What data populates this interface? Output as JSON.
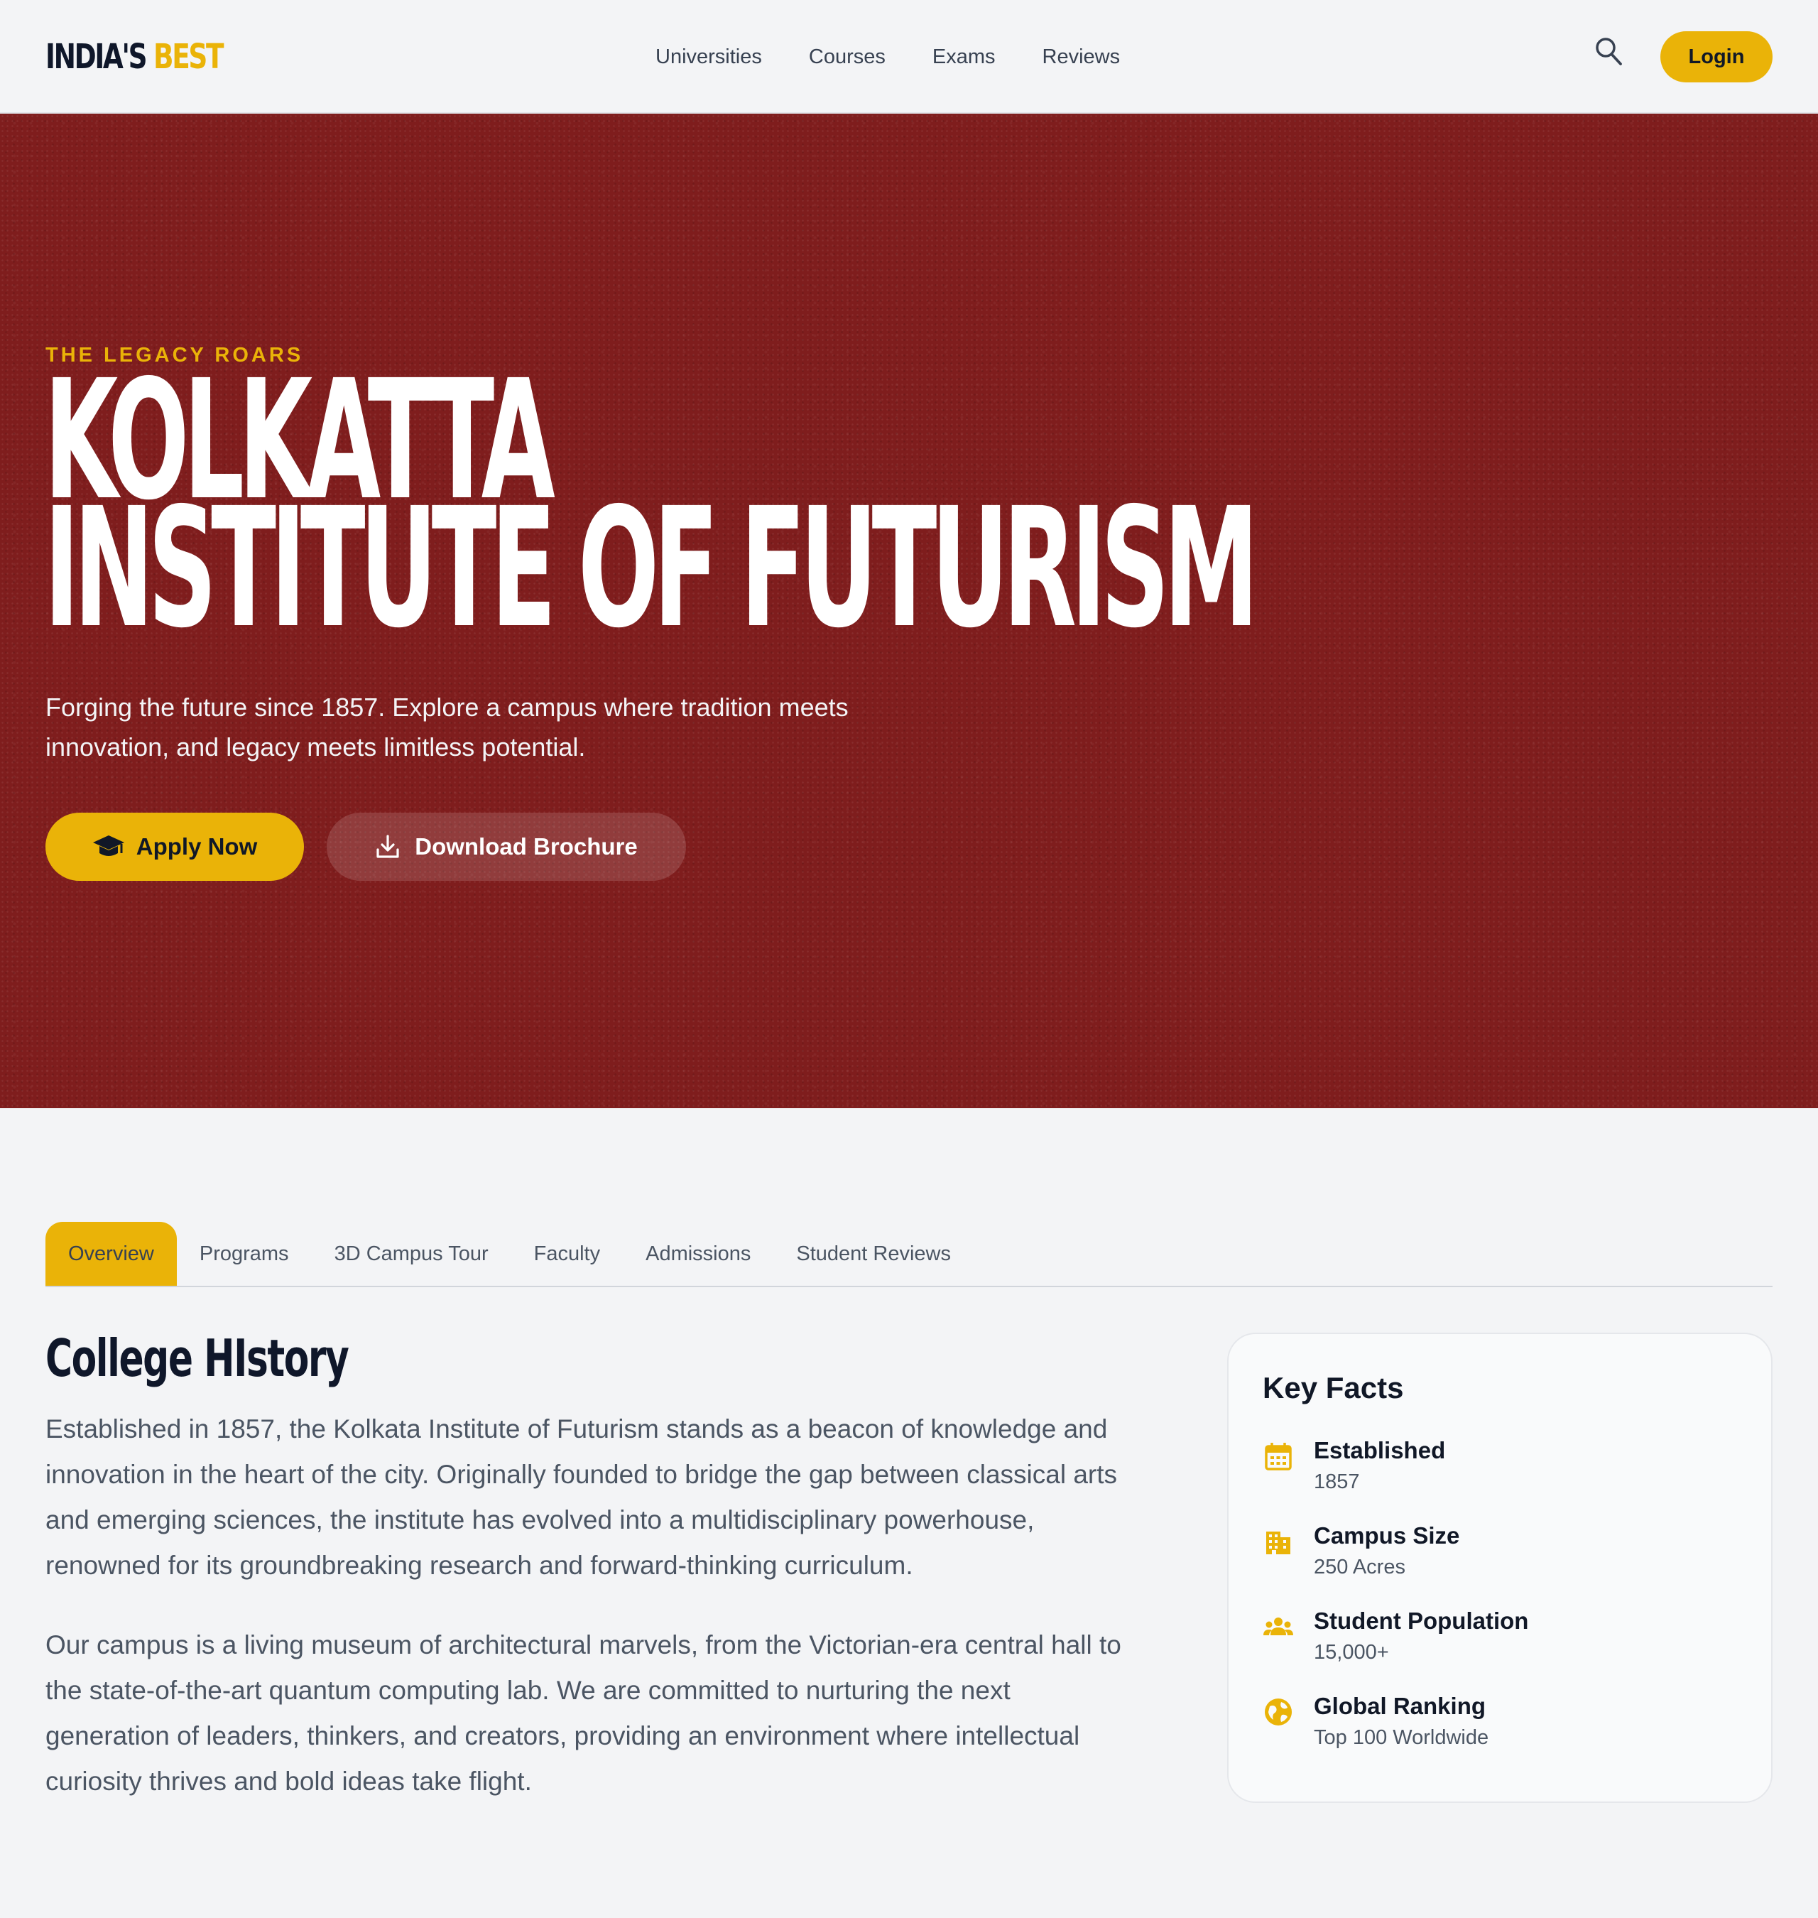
{
  "brand": {
    "part1": "INDIA'S",
    "part2": "BEST"
  },
  "nav": [
    "Universities",
    "Courses",
    "Exams",
    "Reviews"
  ],
  "header": {
    "login_label": "Login"
  },
  "hero": {
    "tagline": "THE LEGACY ROARS",
    "title_line1": "KOLKATTA",
    "title_line2": "INSTITUTE OF FUTURISM",
    "desc_line1": "Forging the future since 1857. Explore a campus where tradition meets",
    "desc_line2": "innovation, and legacy meets limitless potential.",
    "apply_label": "Apply Now",
    "brochure_label": "Download Brochure",
    "background_color": "#7f1d1d"
  },
  "tabs": [
    "Overview",
    "Programs",
    "3D Campus Tour",
    "Faculty",
    "Admissions",
    "Student Reviews"
  ],
  "active_tab": "Overview",
  "history": {
    "title": "College HIstory",
    "p1": [
      "Established in 1857, the Kolkata Institute of Futurism stands as a beacon of knowledge and",
      "innovation in the heart of the city. Originally founded to bridge the gap between classical arts",
      "and emerging sciences, the institute has evolved into a multidisciplinary powerhouse,",
      "renowned for its groundbreaking research and forward-thinking curriculum."
    ],
    "p2": [
      "Our campus is a living museum of architectural marvels, from the Victorian-era central hall to",
      "the state-of-the-art quantum computing lab. We are committed to nurturing the next",
      "generation of leaders, thinkers, and creators, providing an environment where intellectual",
      "curiosity thrives and bold ideas take flight."
    ]
  },
  "key_facts": {
    "title": "Key Facts",
    "items": [
      {
        "icon": "calendar-icon",
        "label": "Established",
        "value": "1857"
      },
      {
        "icon": "building-icon",
        "label": "Campus Size",
        "value": "250 Acres"
      },
      {
        "icon": "group-icon",
        "label": "Student Population",
        "value": "15,000+"
      },
      {
        "icon": "globe-icon",
        "label": "Global Ranking",
        "value": "Top 100 Worldwide"
      }
    ]
  },
  "colors": {
    "accent": "#eab308",
    "hero_bg": "#7f1d1d",
    "page_bg": "#f3f4f6",
    "text_dark": "#0f172a"
  }
}
